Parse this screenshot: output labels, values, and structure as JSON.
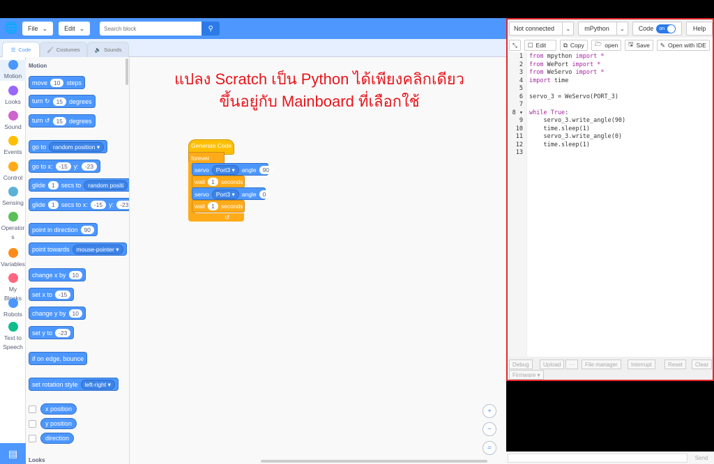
{
  "menu": {
    "file": "File",
    "edit": "Edit",
    "search_placeholder": "Search block"
  },
  "tabs": {
    "code": "Code",
    "costumes": "Costumes",
    "sounds": "Sounds"
  },
  "categories": [
    {
      "label": "Motion",
      "color": "#4c97ff"
    },
    {
      "label": "Looks",
      "color": "#9966ff"
    },
    {
      "label": "Sound",
      "color": "#cf63cf"
    },
    {
      "label": "Events",
      "color": "#ffbf00"
    },
    {
      "label": "Control",
      "color": "#ffab19"
    },
    {
      "label": "Sensing",
      "color": "#5cb1d6"
    },
    {
      "label": "Operator s",
      "color": "#59c059"
    },
    {
      "label": "Variables",
      "color": "#ff8c1a"
    },
    {
      "label": "My Blocks",
      "color": "#ff6680"
    },
    {
      "label": "Robots",
      "color": "#4c97ff"
    },
    {
      "label": "Text to Speech",
      "color": "#0fbd8c"
    }
  ],
  "palette": {
    "section_motion": "Motion",
    "section_looks": "Looks",
    "move": {
      "a": "move",
      "v": "10",
      "b": "steps"
    },
    "turn_right": {
      "a": "turn ↻",
      "v": "15",
      "b": "degrees"
    },
    "turn_left": {
      "a": "turn ↺",
      "v": "15",
      "b": "degrees"
    },
    "goto": {
      "a": "go to",
      "dd": "random position ▾"
    },
    "goto_xy": {
      "a": "go to x:",
      "x": "-15",
      "b": "y:",
      "y": "-23"
    },
    "glide_to": {
      "a": "glide",
      "v": "1",
      "b": "secs to",
      "dd": "random positi"
    },
    "glide_xy": {
      "a": "glide",
      "v": "1",
      "b": "secs to x:",
      "x": "-15",
      "c": "y:",
      "y": "-23"
    },
    "point_dir": {
      "a": "point in direction",
      "v": "90"
    },
    "point_towards": {
      "a": "point towards",
      "dd": "mouse-pointer ▾"
    },
    "change_x": {
      "a": "change x by",
      "v": "10"
    },
    "set_x": {
      "a": "set x to",
      "v": "-15"
    },
    "change_y": {
      "a": "change y by",
      "v": "10"
    },
    "set_y": {
      "a": "set y to",
      "v": "-23"
    },
    "bounce": "if on edge, bounce",
    "rotation": {
      "a": "set rotation style",
      "dd": "left-right ▾"
    },
    "xpos": "x position",
    "ypos": "y position",
    "direction": "direction"
  },
  "overlay": {
    "line1": "แปลง Scratch เป็น Python ได้เพียงคลิกเดียว",
    "line2": "ขึ้นอยู่กับ Mainboard ที่เลือกใช้"
  },
  "script": {
    "hat": "Generate Code",
    "forever": "forever",
    "servo1": {
      "a": "servo",
      "port": "Port3 ▾",
      "b": "angle",
      "v": "90"
    },
    "wait1": {
      "a": "wait",
      "v": "1",
      "b": "seconds"
    },
    "servo2": {
      "a": "servo",
      "port": "Port3 ▾",
      "b": "angle",
      "v": "0"
    },
    "wait2": {
      "a": "wait",
      "v": "1",
      "b": "seconds"
    },
    "loop_arrow": "↺"
  },
  "zoom": {
    "in": "+",
    "out": "−",
    "reset": "="
  },
  "right": {
    "connection": "Not connected",
    "language": "mPython",
    "code_label": "Code",
    "toggle": "on",
    "help": "Help",
    "edit": "Edit",
    "copy": "Copy",
    "open": "open",
    "save": "Save",
    "open_ide": "Open with IDE",
    "line_numbers": [
      "1",
      "2",
      "3",
      "4",
      "5",
      "6",
      "7",
      "8 ▾",
      "9",
      "10",
      "11",
      "12",
      "13"
    ],
    "debug": "Debug",
    "upload": "Upload",
    "more": "···",
    "file_manager": "File manager",
    "interrupt": "Interrupt",
    "reset": "Reset",
    "clear": "Clear",
    "firmware": "Firmware ▾",
    "send": "Send"
  },
  "code_lines": [
    [
      {
        "t": "from",
        "k": 1
      },
      {
        "t": " mpython "
      },
      {
        "t": "import *",
        "k": 1
      }
    ],
    [
      {
        "t": "from",
        "k": 1
      },
      {
        "t": " WePort "
      },
      {
        "t": "import *",
        "k": 1
      }
    ],
    [
      {
        "t": "from",
        "k": 1
      },
      {
        "t": " WeServo "
      },
      {
        "t": "import *",
        "k": 1
      }
    ],
    [
      {
        "t": "import",
        "k": 1
      },
      {
        "t": " time"
      }
    ],
    [],
    [
      {
        "t": "servo_3 = WeServo(PORT_3)"
      }
    ],
    [],
    [
      {
        "t": "while True",
        "k": 1
      },
      {
        "t": ":"
      }
    ],
    [
      {
        "t": "    servo_3.write_angle(90)"
      }
    ],
    [
      {
        "t": "    time.sleep(1)"
      }
    ],
    [
      {
        "t": "    servo_3.write_angle(0)"
      }
    ],
    [
      {
        "t": "    time.sleep(1)"
      }
    ],
    []
  ],
  "colors": {
    "accent": "#4d97ff",
    "highlight_border": "#e3282a",
    "overlay_text": "#e8151b"
  }
}
